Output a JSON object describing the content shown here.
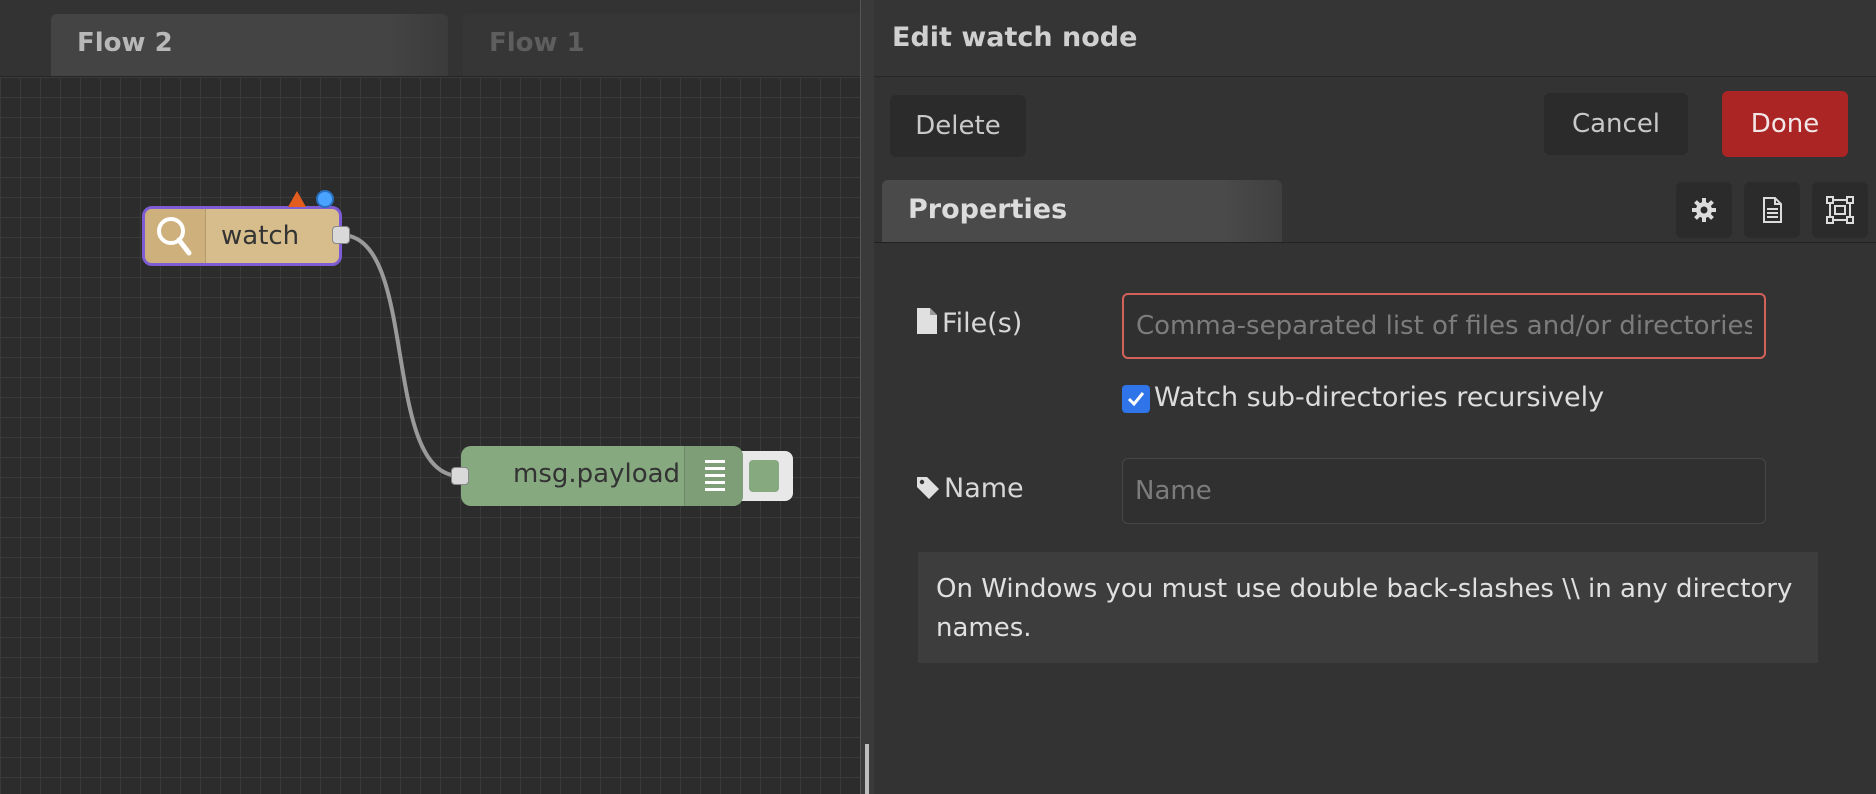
{
  "workspace": {
    "tabs": [
      {
        "label": "Flow 2",
        "active": true
      },
      {
        "label": "Flow 1",
        "active": false
      }
    ],
    "nodes": {
      "watch": {
        "label": "watch",
        "icon": "magnifier-icon",
        "color": "#d8bd8c",
        "selected": true,
        "changed": true,
        "has_warning": true
      },
      "debug": {
        "label": "msg.payload",
        "icon": "list-lines-icon",
        "color": "#87a980"
      }
    }
  },
  "editor": {
    "title": "Edit watch node",
    "buttons": {
      "delete": "Delete",
      "cancel": "Cancel",
      "done": "Done"
    },
    "tabs": [
      {
        "label": "Properties"
      }
    ],
    "tool_icons": [
      "gear-icon",
      "document-icon",
      "frame-icon"
    ],
    "fields": {
      "files": {
        "label": "File(s)",
        "placeholder": "Comma-separated list of files and/or directories",
        "value": "",
        "icon": "file-icon",
        "invalid": true
      },
      "recursive": {
        "label": "Watch sub-directories recursively",
        "checked": true
      },
      "name": {
        "label": "Name",
        "placeholder": "Name",
        "value": "",
        "icon": "tag-icon"
      }
    },
    "tip": "On Windows you must use double back-slashes \\\\ in any directory names."
  },
  "colors": {
    "done_button": "#ab2525",
    "checkbox": "#2f74e8",
    "invalid_border": "#d0625a",
    "selection": "#7d5cd4"
  }
}
